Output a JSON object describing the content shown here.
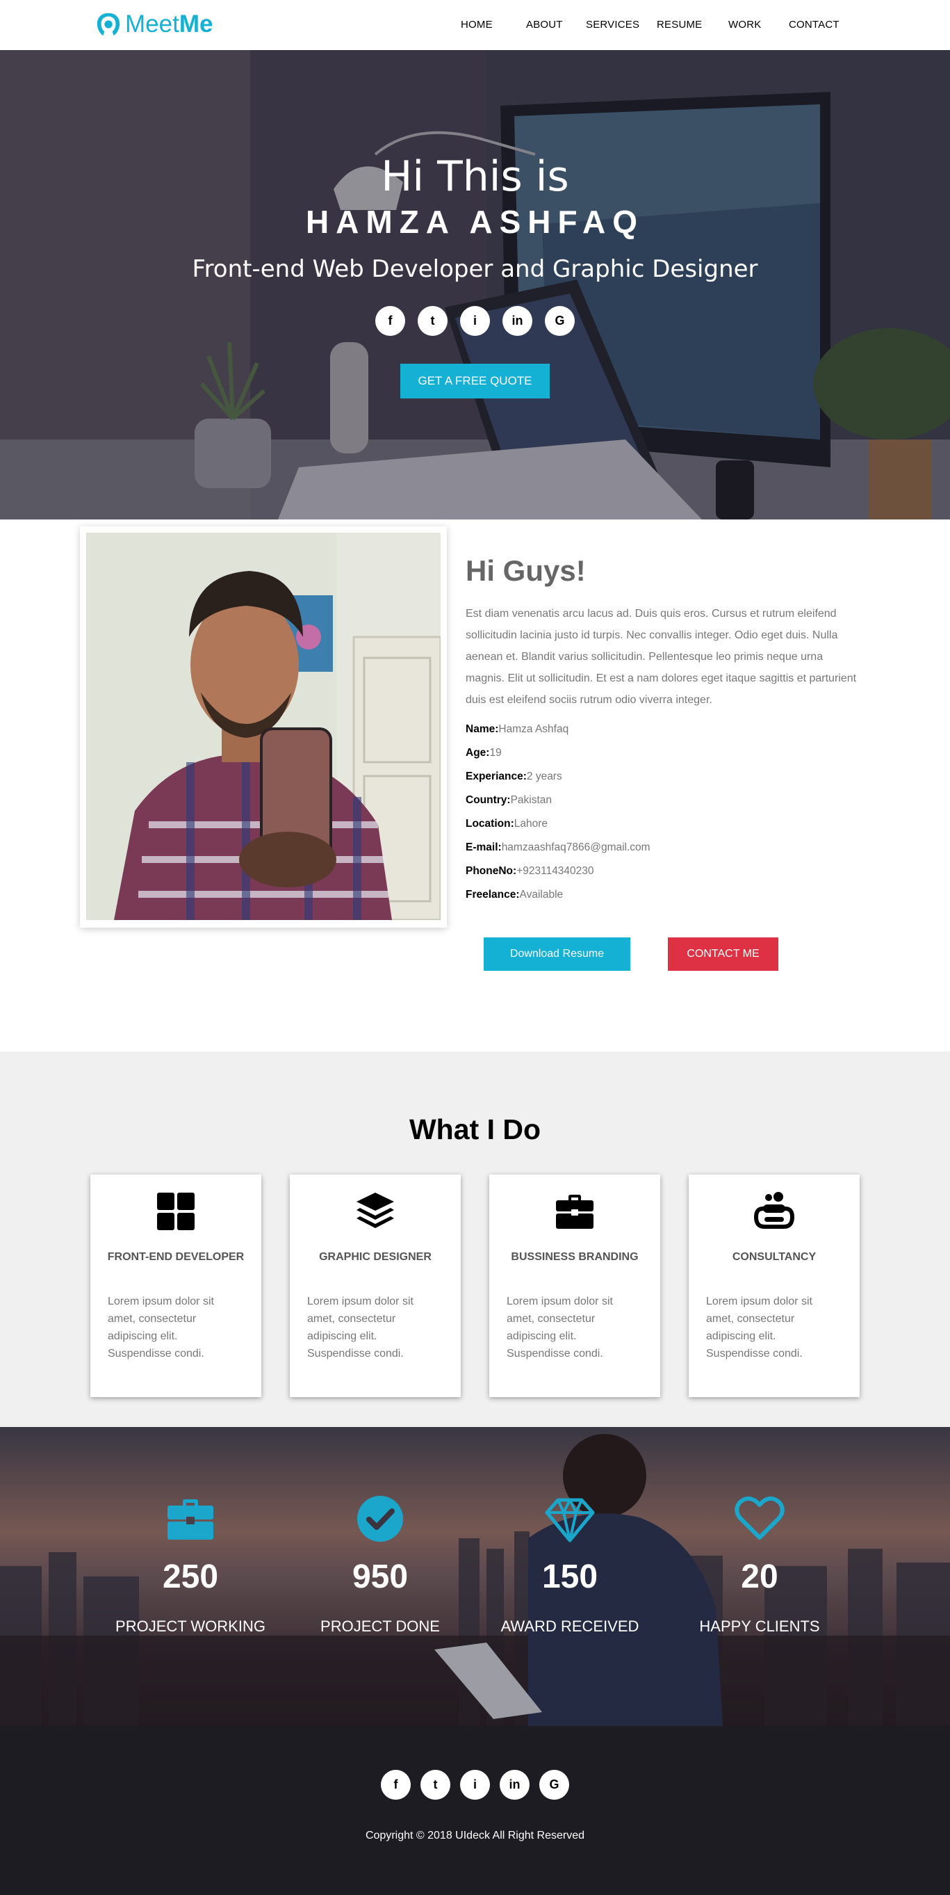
{
  "brand": {
    "light": "Meet",
    "bold": "Me",
    "color": "#14b1d4"
  },
  "nav": {
    "items": [
      {
        "label": "HOME"
      },
      {
        "label": "ABOUT"
      },
      {
        "label": "SERVICES"
      },
      {
        "label": "RESUME"
      },
      {
        "label": "WORK"
      },
      {
        "label": "CONTACT"
      }
    ]
  },
  "hero": {
    "greeting": "Hi This is",
    "name": "HAMZA ASHFAQ",
    "role": "Front-end Web Developer and Graphic Designer",
    "social": [
      {
        "icon": "facebook-icon",
        "glyph": "f"
      },
      {
        "icon": "twitter-icon",
        "glyph": "t"
      },
      {
        "icon": "instagram-icon",
        "glyph": "i"
      },
      {
        "icon": "linkedin-icon",
        "glyph": "in"
      },
      {
        "icon": "google-icon",
        "glyph": "G"
      }
    ],
    "cta_label": "GET A FREE QUOTE"
  },
  "about": {
    "title": "Hi Guys!",
    "description": "Est diam venenatis arcu lacus ad. Duis quis eros. Cursus et rutrum eleifend sollicitudin lacinia justo id turpis. Nec convallis integer. Odio eget duis. Nulla aenean et. Blandit varius sollicitudin. Pellentesque leo primis neque urna magnis. Elit ut sollicitudin. Et est a nam dolores eget itaque sagittis et parturient duis est eleifend sociis rutrum odio viverra integer.",
    "info": [
      {
        "key": "Name:",
        "value": "Hamza Ashfaq"
      },
      {
        "key": "Age:",
        "value": "19"
      },
      {
        "key": "Experiance:",
        "value": "2 years"
      },
      {
        "key": "Country:",
        "value": "Pakistan"
      },
      {
        "key": "Location:",
        "value": "Lahore"
      },
      {
        "key": "E-mail:",
        "value": "hamzaashfaq7866@gmail.com"
      },
      {
        "key": "PhoneNo:",
        "value": "+923114340230"
      },
      {
        "key": "Freelance:",
        "value": "Available"
      }
    ],
    "download_label": "Download Resume",
    "contact_label": "CONTACT ME"
  },
  "services": {
    "title": "What I Do",
    "cards": [
      {
        "icon": "grid-icon",
        "title": "FRONT-END DEVELOPER",
        "text": "Lorem ipsum dolor sit amet, consectetur adipiscing elit. Suspendisse condi."
      },
      {
        "icon": "layers-icon",
        "title": "GRAPHIC DESIGNER",
        "text": "Lorem ipsum dolor sit amet, consectetur adipiscing elit. Suspendisse condi."
      },
      {
        "icon": "briefcase-icon",
        "title": "BUSSINESS BRANDING",
        "text": "Lorem ipsum dolor sit amet, consectetur adipiscing elit. Suspendisse condi."
      },
      {
        "icon": "soap-icon",
        "title": "CONSULTANCY",
        "text": "Lorem ipsum dolor sit amet, consectetur adipiscing elit. Suspendisse condi."
      }
    ]
  },
  "stats": [
    {
      "icon": "briefcase-icon",
      "value": "250",
      "label": "PROJECT WORKING"
    },
    {
      "icon": "check-circle-icon",
      "value": "950",
      "label": "PROJECT DONE"
    },
    {
      "icon": "diamond-icon",
      "value": "150",
      "label": "AWARD RECEIVED"
    },
    {
      "icon": "heart-icon",
      "value": "20",
      "label": "HAPPY CLIENTS"
    }
  ],
  "footer": {
    "social": [
      {
        "icon": "facebook-icon",
        "glyph": "f"
      },
      {
        "icon": "twitter-icon",
        "glyph": "t"
      },
      {
        "icon": "instagram-icon",
        "glyph": "i"
      },
      {
        "icon": "linkedin-icon",
        "glyph": "in"
      },
      {
        "icon": "google-icon",
        "glyph": "G"
      }
    ],
    "copyright": "Copyright © 2018 UIdeck All Right Reserved"
  }
}
